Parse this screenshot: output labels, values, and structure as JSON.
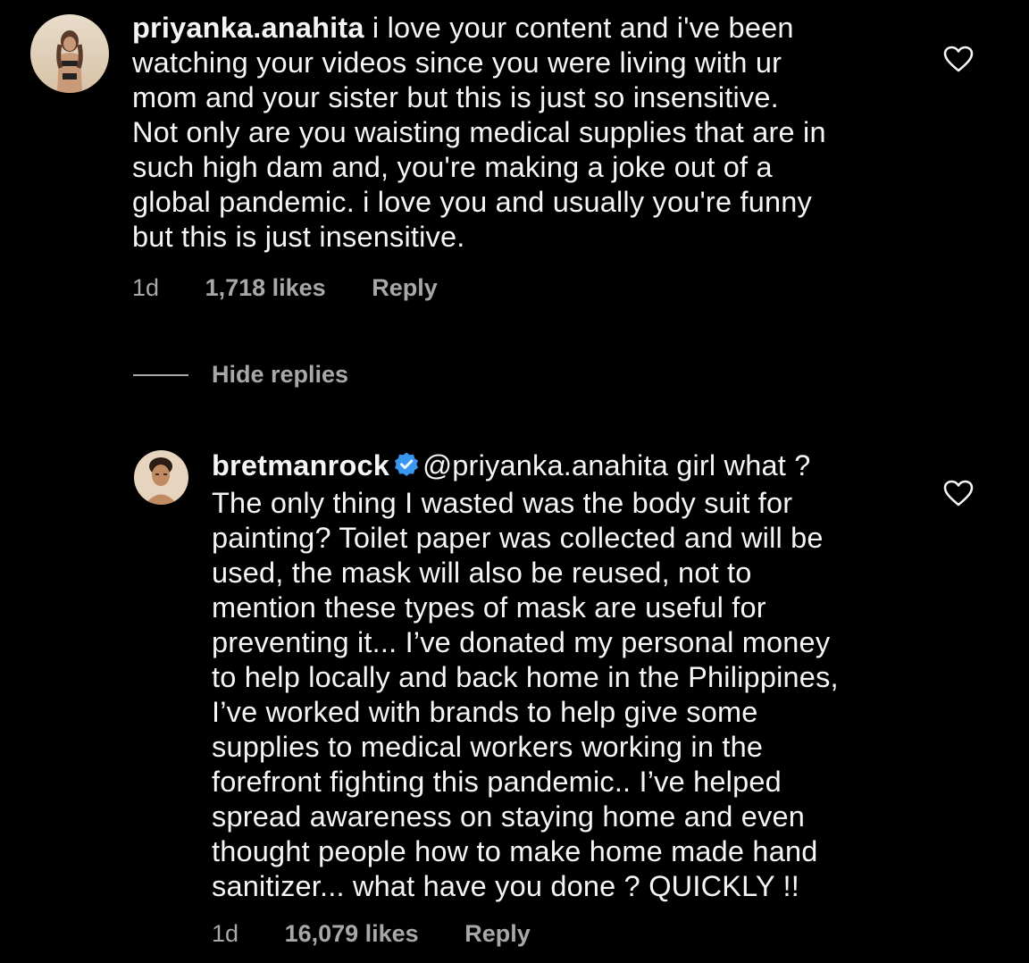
{
  "comments": [
    {
      "username": "priyanka.anahita",
      "text_lines": [
        " i love your content and i've been",
        "watching your videos since you were living with ur",
        "mom and your sister but this is just so insensitive.",
        "Not only are you waisting medical supplies that are in",
        "such high dam and, you're making a joke out of a",
        "global pandemic. i love you and usually you're funny",
        "but this is just insensitive."
      ],
      "time": "1d",
      "likes": "1,718 likes",
      "reply_label": "Reply",
      "verified": false
    },
    {
      "username": "bretmanrock",
      "text_lines": [
        "@priyanka.anahita girl what ?",
        "The only thing I wasted was the body suit for",
        "painting? Toilet paper was collected and will be",
        "used, the mask will also be reused, not to",
        "mention these types of mask are useful for",
        "preventing it... I’ve donated my personal money",
        "to help locally and back home in the Philippines,",
        "I’ve worked with brands to help give some",
        "supplies to medical workers working in the",
        "forefront fighting this pandemic.. I’ve helped",
        "spread awareness on staying home and even",
        "thought people how to make home made hand",
        "sanitizer... what have you done ? QUICKLY !!"
      ],
      "time": "1d",
      "likes": "16,079 likes",
      "reply_label": "Reply",
      "verified": true
    }
  ],
  "hide_replies_label": "Hide replies",
  "icons": {
    "like": "heart-outline-icon",
    "verified": "verified-badge-icon"
  },
  "colors": {
    "background": "#000000",
    "text": "#f5f5f5",
    "secondary": "#a8a8a8",
    "verified": "#3897f0"
  }
}
